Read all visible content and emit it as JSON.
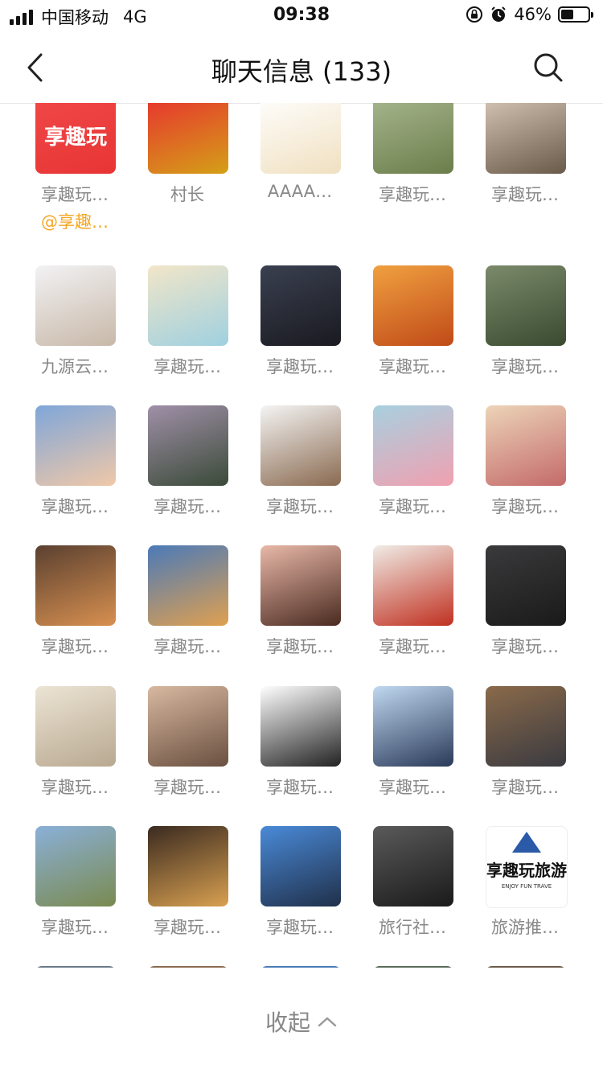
{
  "status_bar": {
    "carrier": "中国移动",
    "network": "4G",
    "time": "09:38",
    "battery_percent": "46%",
    "battery_level": 0.46
  },
  "nav": {
    "title": "聊天信息 (133)",
    "back_icon": "chevron-left-icon",
    "search_icon": "search-icon"
  },
  "members": [
    {
      "name": "享趣玩…",
      "mention": "@享趣…",
      "avatar_label": "享趣玩",
      "colors": [
        "#f04848",
        "#e83535"
      ]
    },
    {
      "name": "村长",
      "colors": [
        "#e83030",
        "#d4a017"
      ]
    },
    {
      "name": "AAAA…",
      "colors": [
        "#ffffff",
        "#f0e0c0"
      ]
    },
    {
      "name": "享趣玩…",
      "colors": [
        "#a8b890",
        "#6b7d4a"
      ]
    },
    {
      "name": "享趣玩…",
      "colors": [
        "#d8c8b8",
        "#6a5a4a"
      ]
    },
    {
      "name": "九源云…",
      "colors": [
        "#f2f2f4",
        "#c8b8a8"
      ]
    },
    {
      "name": "享趣玩…",
      "colors": [
        "#f2e6c8",
        "#9fd0e0"
      ]
    },
    {
      "name": "享趣玩…",
      "colors": [
        "#3a4050",
        "#1a1a20"
      ]
    },
    {
      "name": "享趣玩…",
      "colors": [
        "#f0a040",
        "#c04a18"
      ]
    },
    {
      "name": "享趣玩…",
      "colors": [
        "#7a8a6a",
        "#3a4a30"
      ]
    },
    {
      "name": "享趣玩…",
      "colors": [
        "#7fa6d9",
        "#f0c8a8"
      ]
    },
    {
      "name": "享趣玩…",
      "colors": [
        "#a090a8",
        "#3a4a38"
      ]
    },
    {
      "name": "享趣玩…",
      "colors": [
        "#f4f4f4",
        "#8a6a50"
      ]
    },
    {
      "name": "享趣玩…",
      "colors": [
        "#a8d0e0",
        "#f0a0b0"
      ]
    },
    {
      "name": "享趣玩…",
      "colors": [
        "#ecd4b8",
        "#c46a6a"
      ]
    },
    {
      "name": "享趣玩…",
      "colors": [
        "#5a4030",
        "#d89050"
      ]
    },
    {
      "name": "享趣玩…",
      "colors": [
        "#4a7ab8",
        "#e0a050"
      ]
    },
    {
      "name": "享趣玩…",
      "colors": [
        "#e8b8a8",
        "#4a2a20"
      ]
    },
    {
      "name": "享趣玩…",
      "colors": [
        "#f0ece6",
        "#c03020"
      ]
    },
    {
      "name": "享趣玩…",
      "colors": [
        "#3a3a3c",
        "#1a1a1a"
      ]
    },
    {
      "name": "享趣玩…",
      "colors": [
        "#ece4d4",
        "#b8a890"
      ]
    },
    {
      "name": "享趣玩…",
      "colors": [
        "#d8b8a0",
        "#6a5040"
      ]
    },
    {
      "name": "享趣玩…",
      "colors": [
        "#ffffff",
        "#222222"
      ]
    },
    {
      "name": "享趣玩…",
      "colors": [
        "#c0d8f0",
        "#2a3a5a"
      ]
    },
    {
      "name": "享趣玩…",
      "colors": [
        "#8a6a4a",
        "#3a3a40"
      ]
    },
    {
      "name": "享趣玩…",
      "colors": [
        "#8ab0d8",
        "#7a8a50"
      ]
    },
    {
      "name": "享趣玩…",
      "colors": [
        "#3a2a20",
        "#d8a050"
      ]
    },
    {
      "name": "享趣玩…",
      "colors": [
        "#4a8ad8",
        "#20304a"
      ]
    },
    {
      "name": "旅行社…",
      "colors": [
        "#5a5a5a",
        "#1a1a1a"
      ]
    },
    {
      "name": "旅游推…",
      "avatar_label_dark": "享趣玩旅游",
      "avatar_label_sub": "ENJOY FUN TRAVE",
      "colors": [
        "#ffffff",
        "#ffffff"
      ]
    }
  ],
  "peek_row_colors": [
    "#6a7a88",
    "#8a6a50",
    "#4a7ab8",
    "#5a6a5a",
    "#6a5a48"
  ],
  "collapse": {
    "label": "收起",
    "icon": "chevron-up-icon"
  }
}
